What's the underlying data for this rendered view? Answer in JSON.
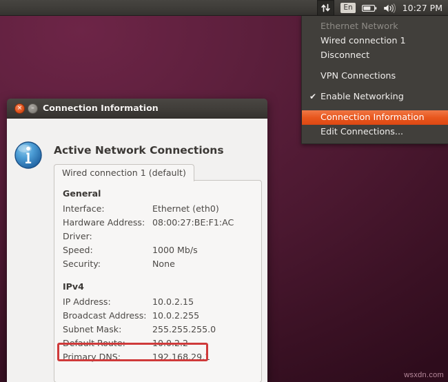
{
  "desktop": {
    "watermark": "wsxdn.com"
  },
  "panel": {
    "icons": [
      {
        "name": "network-arrows-icon",
        "label": "network"
      },
      {
        "name": "keyboard-layout-icon",
        "label": "En"
      },
      {
        "name": "battery-icon",
        "label": "battery"
      },
      {
        "name": "volume-icon",
        "label": "volume"
      }
    ],
    "keyboard_layout": "En",
    "clock": "10:27 PM"
  },
  "network_menu": {
    "items": [
      {
        "label": "Ethernet Network",
        "state": "disabled",
        "check": ""
      },
      {
        "label": "Wired connection 1",
        "state": "normal",
        "check": ""
      },
      {
        "label": "Disconnect",
        "state": "normal",
        "check": ""
      },
      {
        "label": "VPN Connections",
        "state": "normal",
        "check": ""
      },
      {
        "label": "Enable Networking",
        "state": "checked",
        "check": "✔"
      },
      {
        "label": "Connection Information",
        "state": "selected",
        "check": ""
      },
      {
        "label": "Edit Connections...",
        "state": "normal",
        "check": ""
      }
    ]
  },
  "dialog": {
    "title": "Connection Information",
    "close_glyph": "×",
    "minimize_glyph": "–",
    "heading": "Active Network Connections",
    "info_icon_letter": "i",
    "tab": {
      "label": "Wired connection 1 (default)"
    },
    "sections": [
      {
        "title": "General",
        "rows": [
          {
            "key": "Interface:",
            "value": "Ethernet (eth0)"
          },
          {
            "key": "Hardware Address:",
            "value": "08:00:27:BE:F1:AC"
          },
          {
            "key": "Driver:",
            "value": ""
          },
          {
            "key": "Speed:",
            "value": "1000 Mb/s"
          },
          {
            "key": "Security:",
            "value": "None"
          }
        ]
      },
      {
        "title": "IPv4",
        "rows": [
          {
            "key": "IP Address:",
            "value": "10.0.2.15"
          },
          {
            "key": "Broadcast Address:",
            "value": "10.0.2.255"
          },
          {
            "key": "Subnet Mask:",
            "value": "255.255.255.0"
          },
          {
            "key": "Default Route:",
            "value": "10.0.2.2"
          },
          {
            "key": "Primary DNS:",
            "value": "192.168.29.1"
          }
        ]
      }
    ]
  },
  "annotation": {
    "target": "Default Route:",
    "color": "#cf3a3a"
  },
  "colors": {
    "accent_orange": "#dd4814",
    "panel_bg": "#413f3b",
    "dialog_bg": "#f2f1f0",
    "annotation_red": "#cf3a3a"
  }
}
